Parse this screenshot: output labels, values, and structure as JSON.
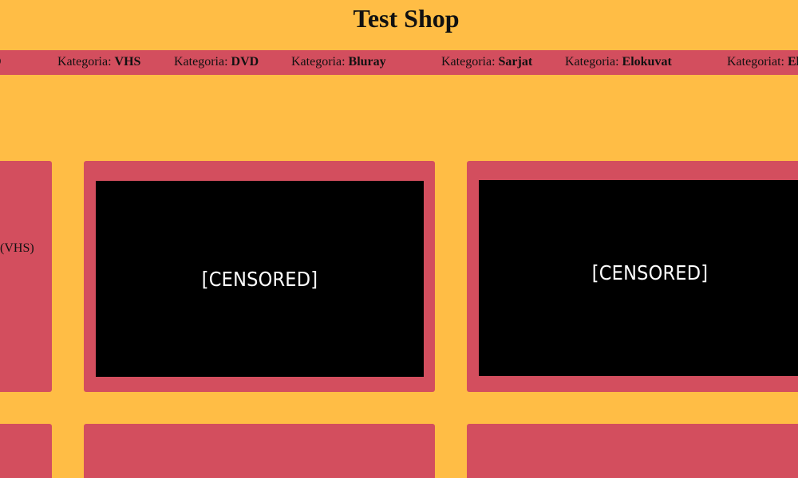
{
  "app": {
    "title": "Test Shop"
  },
  "nav": {
    "clipped_start": "D",
    "items": [
      {
        "label": "Kategoria: ",
        "value": "VHS"
      },
      {
        "label": "Kategoria: ",
        "value": "DVD"
      },
      {
        "label": "Kategoria: ",
        "value": "Bluray"
      },
      {
        "label": "Kategoria: ",
        "value": "Sarjat"
      },
      {
        "label": "Kategoria: ",
        "value": "Elokuvat"
      },
      {
        "label": "Kategoriat: ",
        "value": "El"
      }
    ]
  },
  "cards": [
    {
      "text": "(VHS)"
    },
    {
      "image_text": "[CENSORED]"
    },
    {
      "image_text": "[CENSORED]"
    }
  ],
  "colors": {
    "background": "#FFBD45",
    "card": "#D34E5E",
    "nav": "#D34E5E",
    "media": "#000000",
    "text": "#111111",
    "censored_text": "#FFFFFF"
  }
}
